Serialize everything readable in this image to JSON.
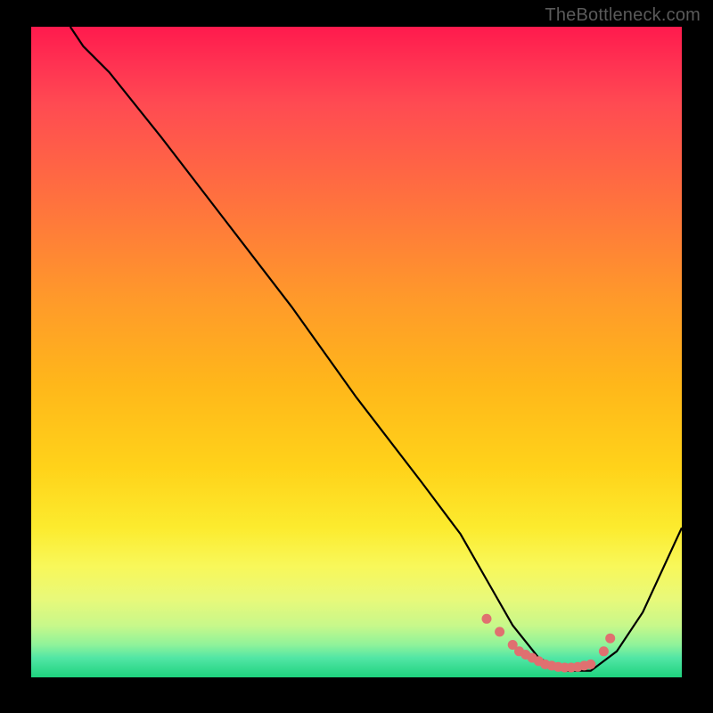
{
  "watermark": "TheBottleneck.com",
  "chart_data": {
    "type": "line",
    "title": "",
    "xlabel": "",
    "ylabel": "",
    "xlim": [
      0,
      100
    ],
    "ylim": [
      0,
      100
    ],
    "series": [
      {
        "name": "curve",
        "color": "#000000",
        "x": [
          6,
          8,
          12,
          20,
          30,
          40,
          50,
          60,
          66,
          70,
          74,
          78,
          82,
          86,
          90,
          94,
          100
        ],
        "values": [
          100,
          97,
          93,
          83,
          70,
          57,
          43,
          30,
          22,
          15,
          8,
          3,
          1,
          1,
          4,
          10,
          23
        ]
      },
      {
        "name": "highlight-dots",
        "color": "#e07070",
        "type": "scatter",
        "x": [
          70,
          72,
          74,
          75,
          76,
          77,
          78,
          79,
          80,
          81,
          82,
          83,
          84,
          85,
          86,
          88,
          89
        ],
        "values": [
          9,
          7,
          5,
          4,
          3.5,
          3,
          2.5,
          2,
          1.8,
          1.6,
          1.5,
          1.5,
          1.6,
          1.8,
          2,
          4,
          6
        ]
      }
    ],
    "gradient_stops": [
      {
        "pos": 0.0,
        "color": "#ff1a4d"
      },
      {
        "pos": 0.2,
        "color": "#ff6047"
      },
      {
        "pos": 0.42,
        "color": "#ff9a2a"
      },
      {
        "pos": 0.68,
        "color": "#ffd31a"
      },
      {
        "pos": 0.83,
        "color": "#f8f85a"
      },
      {
        "pos": 0.95,
        "color": "#8ff39a"
      },
      {
        "pos": 1.0,
        "color": "#1ed27e"
      }
    ]
  }
}
